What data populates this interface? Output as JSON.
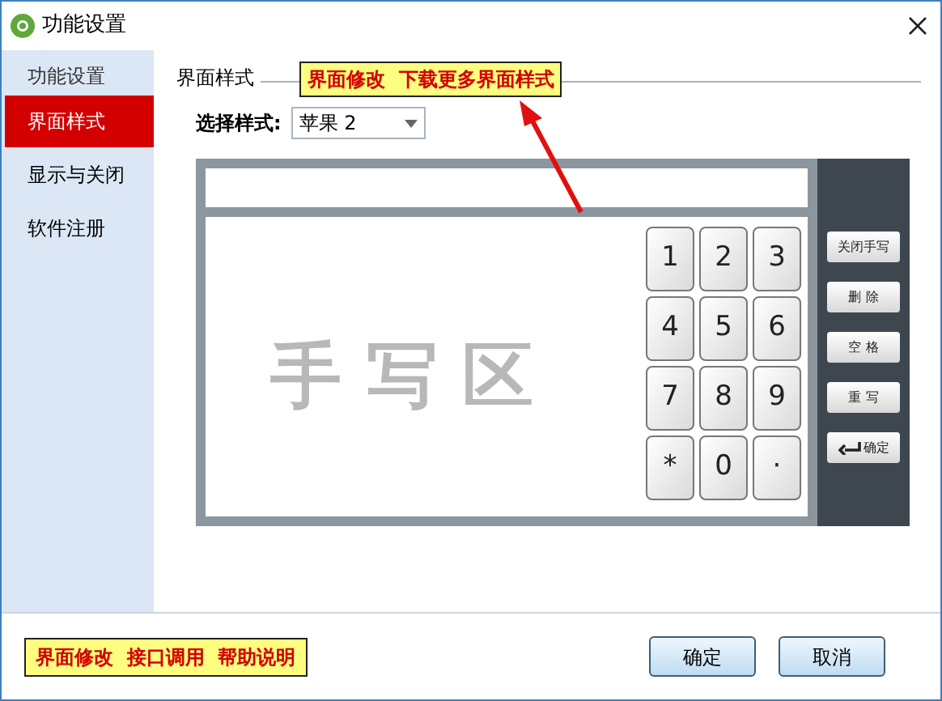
{
  "window": {
    "title": "功能设置"
  },
  "sidebar": {
    "header": "功能设置",
    "items": [
      {
        "label": "界面样式",
        "selected": true
      },
      {
        "label": "显示与关闭",
        "selected": false
      },
      {
        "label": "软件注册",
        "selected": false
      }
    ]
  },
  "section": {
    "title": "界面样式",
    "callout": "界面修改  下载更多界面样式"
  },
  "style_select": {
    "label": "选择样式:",
    "value": "苹果 2"
  },
  "keyboard": {
    "hint": "手 写 区",
    "keys": [
      "1",
      "2",
      "3",
      "4",
      "5",
      "6",
      "7",
      "8",
      "9",
      "*",
      "0",
      "·"
    ],
    "side_buttons": [
      {
        "label": "关闭手写",
        "kind": "text"
      },
      {
        "label": "删 除",
        "kind": "text"
      },
      {
        "label": "空 格",
        "kind": "text"
      },
      {
        "label": "重 写",
        "kind": "text"
      },
      {
        "label": "确定",
        "kind": "enter"
      }
    ]
  },
  "footer": {
    "note": "界面修改  接口调用  帮助说明",
    "buttons": [
      "确定",
      "取消"
    ]
  }
}
